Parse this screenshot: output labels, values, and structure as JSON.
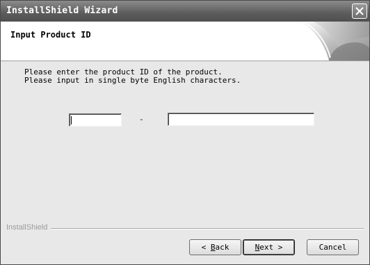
{
  "window": {
    "title": "InstallShield Wizard",
    "close_icon": "close-icon"
  },
  "header": {
    "title": "Input Product ID"
  },
  "body": {
    "instruction_line1": "Please enter the product ID of the product.",
    "instruction_line2": "Please input in single byte English characters.",
    "separator": "-",
    "field1_value": "",
    "field2_value": ""
  },
  "footer": {
    "brand": "InstallShield",
    "back_mnemonic": "B",
    "back_rest": "ack",
    "back_prefix": "< ",
    "next_mnemonic": "N",
    "next_rest": "ext >",
    "cancel_label": "Cancel"
  }
}
